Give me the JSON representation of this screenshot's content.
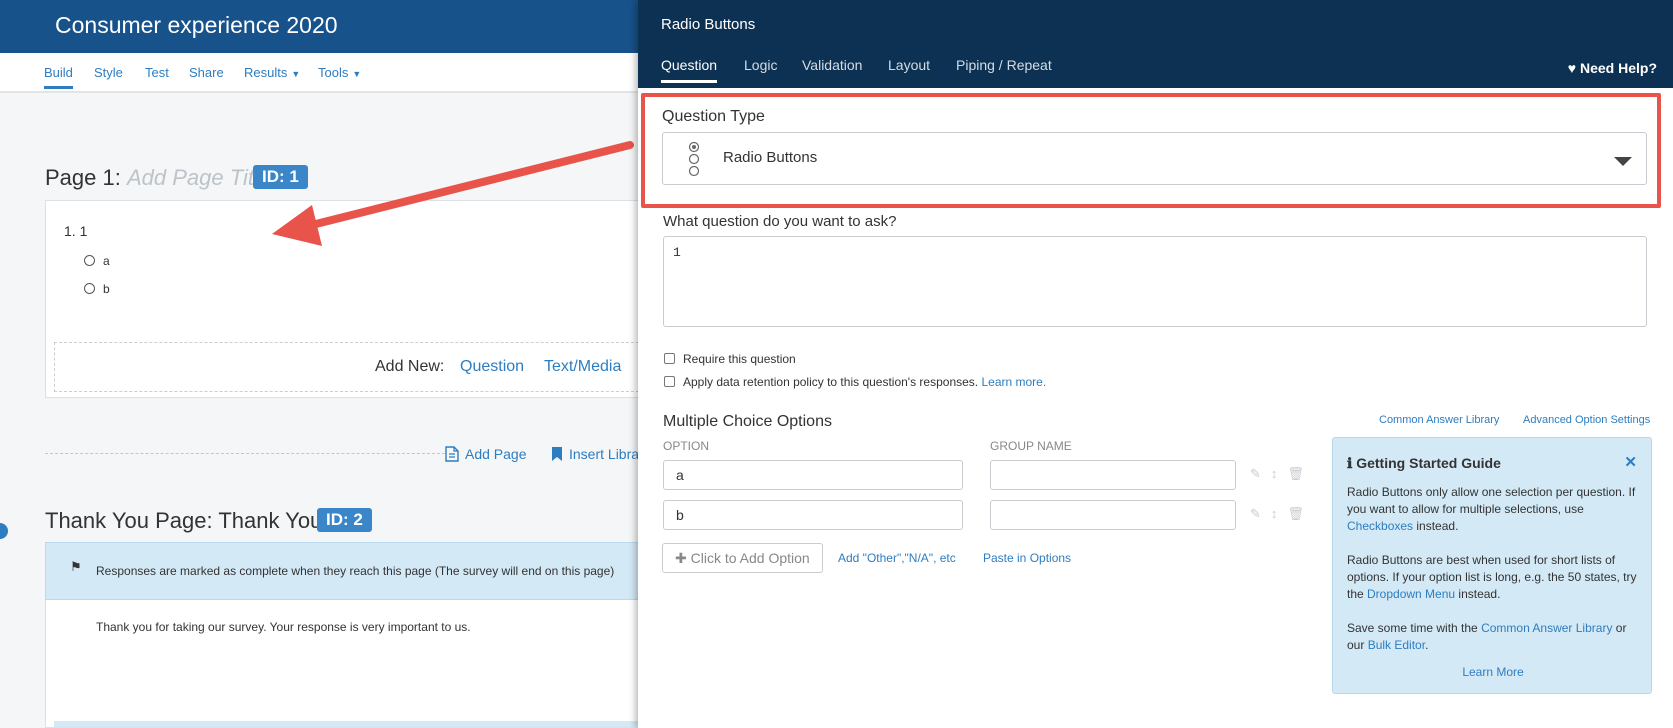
{
  "builder": {
    "survey_title": "Consumer experience 2020",
    "nav": [
      {
        "label": "Build"
      },
      {
        "label": "Style"
      },
      {
        "label": "Test"
      },
      {
        "label": "Share"
      },
      {
        "label": "Results"
      },
      {
        "label": "Tools"
      }
    ],
    "page1": {
      "prefix": "Page 1:",
      "title_placeholder": "Add Page Title",
      "id_badge": "ID: 1",
      "question_number": "1. 1",
      "options": [
        "a",
        "b"
      ],
      "add_new_label": "Add New:",
      "add_question": "Question",
      "add_text_media": "Text/Media"
    },
    "add_page": "Add Page",
    "insert_library": "Insert Libra",
    "thank_you": {
      "prefix": "Thank You Page:",
      "title": "Thank You!",
      "id_badge": "ID: 2",
      "banner_text": "Responses are marked as complete when they reach this page (The survey will end on this page)",
      "body_text": "Thank you for taking our survey. Your response is very important to us."
    }
  },
  "panel": {
    "title": "Radio Buttons",
    "tabs": [
      {
        "label": "Question",
        "active": true
      },
      {
        "label": "Logic"
      },
      {
        "label": "Validation"
      },
      {
        "label": "Layout"
      },
      {
        "label": "Piping / Repeat"
      }
    ],
    "need_help": "Need Help?",
    "question_type_label": "Question Type",
    "question_type_value": "Radio Buttons",
    "ask_label": "What question do you want to ask?",
    "ask_value": "1",
    "require_label": "Require this question",
    "retention_label": "Apply data retention policy to this question's responses.",
    "retention_link": "Learn more.",
    "mco_label": "Multiple Choice Options",
    "common_answer_library": "Common Answer Library",
    "advanced_option_settings": "Advanced Option Settings",
    "col_option": "OPTION",
    "col_group": "GROUP NAME",
    "options": [
      "a",
      "b"
    ],
    "add_option_button": "Click to Add Option",
    "add_other": "Add \"Other\",\"N/A\", etc",
    "paste_options": "Paste in Options",
    "guide": {
      "title": "Getting Started Guide",
      "p1_a": "Radio Buttons only allow one selection per question. If you want to allow for multiple selections, use ",
      "p1_link": "Checkboxes",
      "p1_b": " instead.",
      "p2_a": "Radio Buttons are best when used for short lists of options. If your option list is long, e.g. the 50 states, try the ",
      "p2_link": "Dropdown Menu",
      "p2_b": " instead.",
      "p3_a": "Save some time with the ",
      "p3_link1": "Common Answer Library",
      "p3_b": " or our ",
      "p3_link2": "Bulk Editor",
      "p3_c": ".",
      "learn_more": "Learn More"
    }
  },
  "colors": {
    "builder_header": "#17528a",
    "panel_header": "#0d3152",
    "link": "#2e7dc0",
    "highlight_box": "#e8534a",
    "badge": "#3a86c8",
    "info_bg": "#d3e9f6"
  },
  "icons": [
    "flag-icon",
    "page-icon",
    "bookmark-icon",
    "radio-stack-icon",
    "heart-icon",
    "plus-icon",
    "pencil-icon",
    "move-icon",
    "trash-icon",
    "info-icon",
    "close-icon",
    "caret-down-icon",
    "arrow-annotation"
  ]
}
